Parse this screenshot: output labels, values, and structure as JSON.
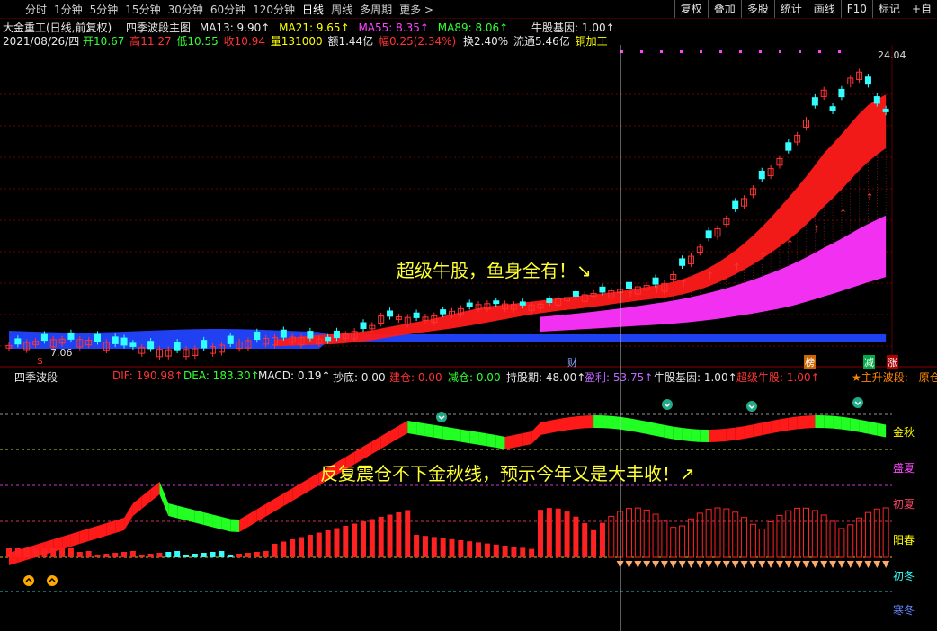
{
  "toolbar": {
    "periods": [
      "分时",
      "1分钟",
      "5分钟",
      "15分钟",
      "30分钟",
      "60分钟",
      "120分钟",
      "日线",
      "周线",
      "多周期",
      "更多 >"
    ],
    "active_period": "日线",
    "right_buttons": [
      "复权",
      "叠加",
      "多股",
      "统计",
      "画线",
      "F10",
      "标记",
      "+自"
    ]
  },
  "header": {
    "stock_name": "大金重工(日线,前复权)",
    "indicator_title": "四季波段主图",
    "ma13": "MA13: 9.90↑",
    "ma21": "MA21: 9.65↑",
    "ma55": "MA55: 8.35↑",
    "ma89": "MA89: 8.06↑",
    "niu_gene": "牛股基因: 1.00↑"
  },
  "quote": {
    "date": "2021/08/26/四",
    "open": "开10.67",
    "high": "高11.27",
    "low": "低10.55",
    "close": "收10.94",
    "volume": "量131000",
    "amount": "额1.44亿",
    "change": "幅0.25(2.34%)",
    "turnover": "换2.40%",
    "float": "流通5.46亿",
    "sector": "铜加工"
  },
  "main_chart": {
    "price_high": "24.04",
    "price_low": "7.06",
    "annotation": "超级牛股，鱼身全有！↘",
    "tag_cai": "财",
    "tag_bang": "榜",
    "tag_jian": "减",
    "tag_zhang": "涨",
    "tag_dollar": "$"
  },
  "sub_header": {
    "name": "四季波段",
    "dif": "DIF: 190.98↑",
    "dea": "DEA: 183.30↑",
    "macd": "MACD: 0.19↑",
    "chaodi": "抄底: 0.00",
    "jiancang": "建仓: 0.00",
    "jiancang2": "减仓: 0.00",
    "chigu": "持股期: 48.00↑",
    "yingli": "盈利: 53.75↑",
    "niu_gene": "牛股基因: 1.00↑",
    "super_niu": "超级牛股: 1.00↑",
    "zhusheng": "★主升波段: - 原仓"
  },
  "sub_chart": {
    "annotation": "反复震仓不下金秋线，预示今年又是大丰收！↗",
    "levels": [
      "金秋",
      "盛夏",
      "初夏",
      "阳春",
      "初冬",
      "寒冬"
    ]
  }
}
